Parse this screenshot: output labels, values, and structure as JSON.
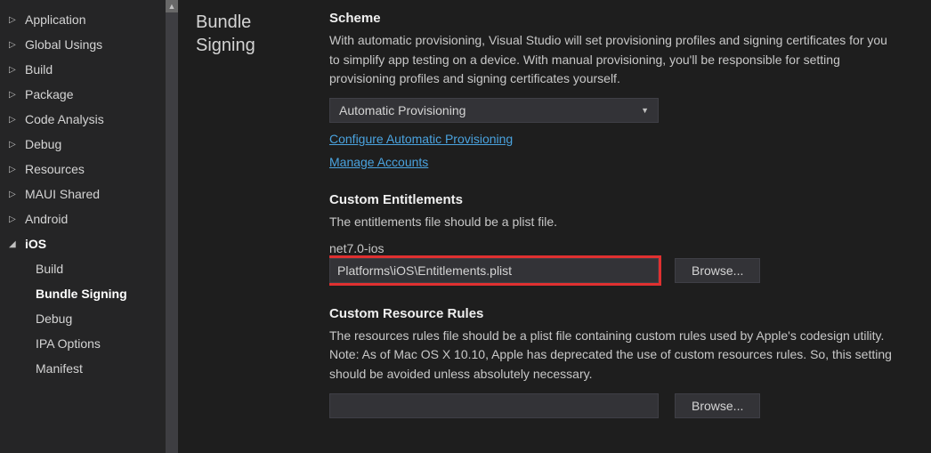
{
  "sidebar": {
    "items": [
      {
        "label": "Application"
      },
      {
        "label": "Global Usings"
      },
      {
        "label": "Build"
      },
      {
        "label": "Package"
      },
      {
        "label": "Code Analysis"
      },
      {
        "label": "Debug"
      },
      {
        "label": "Resources"
      },
      {
        "label": "MAUI Shared"
      },
      {
        "label": "Android"
      }
    ],
    "expanded": {
      "label": "iOS",
      "children": [
        {
          "label": "Build"
        },
        {
          "label": "Bundle Signing"
        },
        {
          "label": "Debug"
        },
        {
          "label": "IPA Options"
        },
        {
          "label": "Manifest"
        }
      ]
    }
  },
  "section_title_line1": "Bundle",
  "section_title_line2": "Signing",
  "scheme": {
    "label": "Scheme",
    "desc": "With automatic provisioning, Visual Studio will set provisioning profiles and signing certificates for you to simplify app testing on a device. With manual provisioning, you'll be responsible for setting provisioning profiles and signing certificates yourself.",
    "dropdown_value": "Automatic Provisioning",
    "link1": "Configure Automatic Provisioning",
    "link2": "Manage Accounts"
  },
  "entitlements": {
    "label": "Custom Entitlements",
    "desc": "The entitlements file should be a plist file.",
    "target": "net7.0-ios",
    "value": "Platforms\\iOS\\Entitlements.plist",
    "browse": "Browse..."
  },
  "resource_rules": {
    "label": "Custom Resource Rules",
    "desc": "The resources rules file should be a plist file containing custom rules used by Apple's codesign utility. Note: As of Mac OS X 10.10, Apple has deprecated the use of custom resources rules. So, this setting should be avoided unless absolutely necessary.",
    "value": "",
    "browse": "Browse..."
  }
}
